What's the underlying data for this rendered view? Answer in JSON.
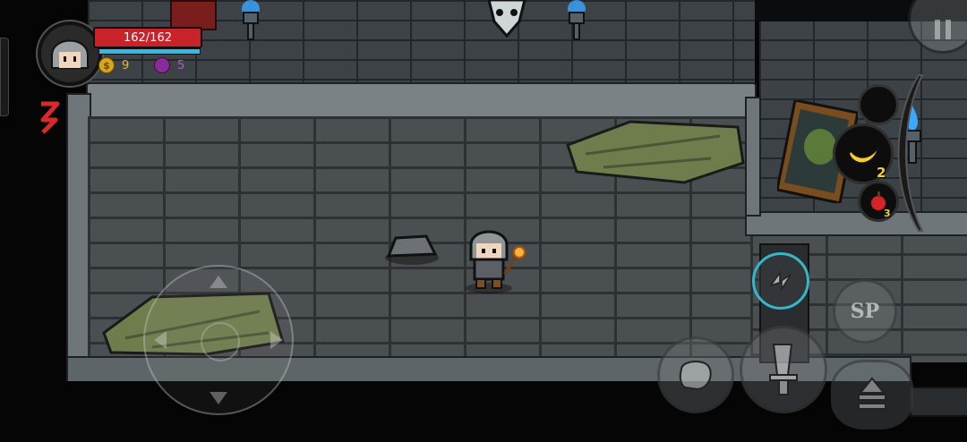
{
  "player": {
    "hp_text": "162/162",
    "hp_fraction": 1.0,
    "mp_fraction": 1.0
  },
  "currency": {
    "gold": "9",
    "souls": "5"
  },
  "inventory": {
    "banana_count": "2",
    "apple_count": "3"
  },
  "skills": {
    "sp_label": "SP"
  },
  "colors": {
    "hp": "#c9232a",
    "mp": "#36b7e6",
    "gold": "#d9a520",
    "soul": "#8a2b9c",
    "torch_flame": "#3aa8ff",
    "dash_ring": "#38b6c9"
  }
}
